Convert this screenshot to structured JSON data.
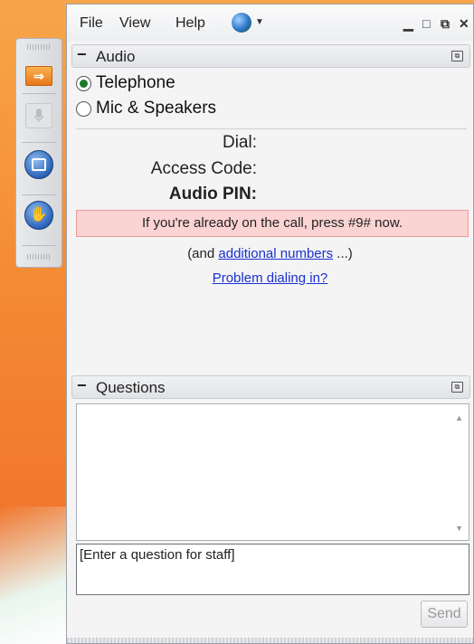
{
  "menu": {
    "file": "File",
    "view": "View",
    "help": "Help",
    "language_icon": "globe-icon"
  },
  "window_controls": {
    "minimize": "▁",
    "restore": "□",
    "popout": "⧉",
    "close": "✕"
  },
  "toolbar": {
    "items": [
      "arrow-icon",
      "microphone-icon",
      "stop-share-icon",
      "raise-hand-icon"
    ]
  },
  "audio": {
    "title": "Audio",
    "options": [
      {
        "label": "Telephone",
        "checked": true
      },
      {
        "label": "Mic & Speakers",
        "checked": false
      }
    ],
    "dial_label": "Dial:",
    "access_code_label": "Access Code:",
    "audio_pin_label": "Audio PIN:",
    "notice": "If you're already on the call, press #9# now.",
    "additional_prefix": "(and ",
    "additional_link": "additional numbers",
    "additional_suffix": " ...)",
    "problem_link": "Problem dialing in?"
  },
  "questions": {
    "title": "Questions",
    "input_placeholder": "[Enter a question for staff]",
    "send_label": "Send"
  },
  "colors": {
    "desktop": "#f48a33",
    "notice_bg": "#fbd3d3",
    "link": "#1a2fcf",
    "radio_checked": "#1c7a2a"
  }
}
